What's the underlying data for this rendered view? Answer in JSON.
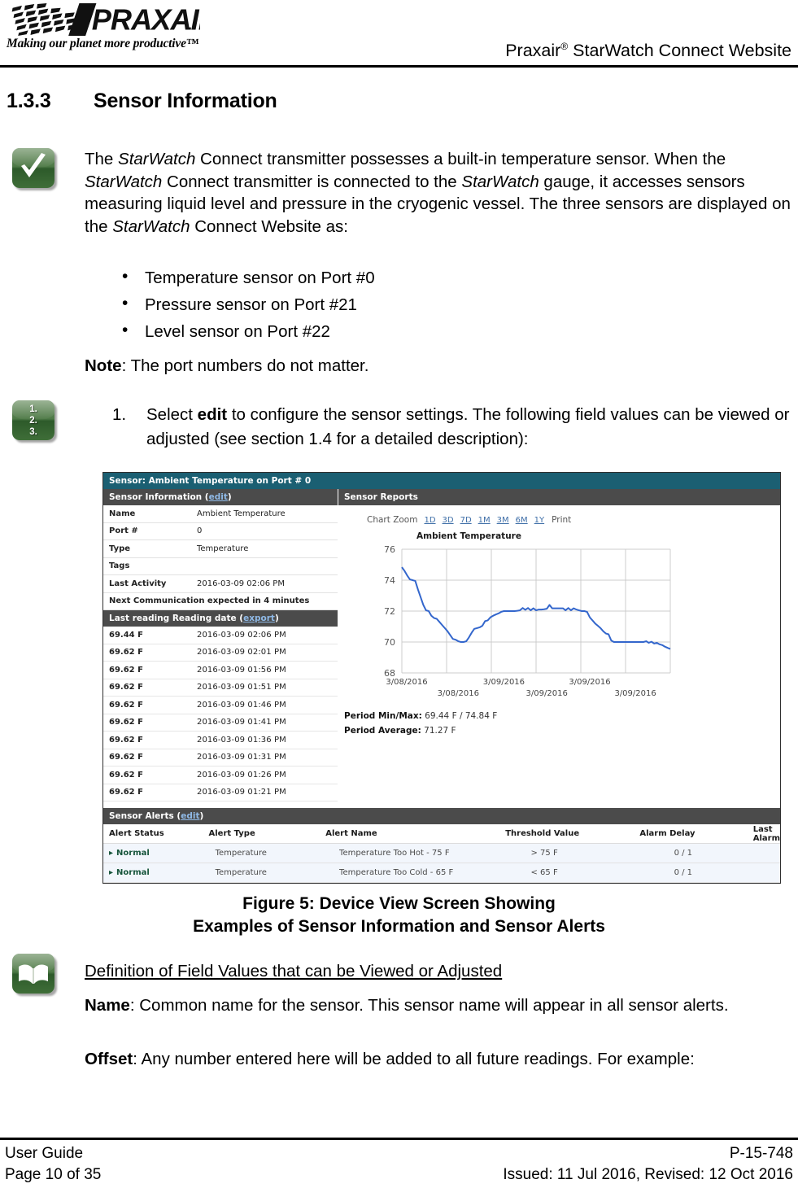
{
  "header": {
    "logo_text": "PRAXAIR",
    "logo_tagline": "Making our planet more productive™",
    "title_main": "Praxair",
    "title_sup": "®",
    "title_rest": " StarWatch Connect Website"
  },
  "section": {
    "number": "1.3.3",
    "title": "Sensor Information"
  },
  "intro": {
    "html": "The <i>StarWatch</i> Connect transmitter possesses a built-in temperature sensor.  When the <i>StarWatch</i> Connect transmitter is connected to the <i>StarWatch</i> gauge, it accesses sensors measuring liquid level and pressure in the cryogenic vessel.  The three sensors are displayed on the <i>StarWatch</i> Connect Website as:"
  },
  "bullets": [
    "Temperature sensor on Port #0",
    "Pressure sensor on Port #21",
    "Level sensor on Port #22"
  ],
  "note": {
    "label": "Note",
    "text": ":  The port numbers do not matter."
  },
  "step": {
    "number": "1.",
    "html": "Select <b>edit</b> to configure the sensor settings.  The following field values can be viewed or adjusted (see section 1.4 for a detailed description):"
  },
  "screenshot": {
    "titlebar": "Sensor: Ambient Temperature on Port # 0",
    "sensor_information": {
      "header_label": "Sensor Information (",
      "header_link": "edit",
      "header_close": ")",
      "rows": [
        {
          "key": "Name",
          "value": "Ambient Temperature"
        },
        {
          "key": "Port #",
          "value": "0"
        },
        {
          "key": "Type",
          "value": "Temperature"
        },
        {
          "key": "Tags",
          "value": ""
        },
        {
          "key": "Last Activity",
          "value": "2016-03-09 02:06 PM"
        }
      ],
      "next_comm": "Next Communication expected in 4 minutes"
    },
    "readings": {
      "header_label": "Last reading Reading date (",
      "header_link": "export",
      "header_close": ")",
      "rows": [
        {
          "reading": "69.44 F",
          "date": "2016-03-09 02:06 PM"
        },
        {
          "reading": "69.62 F",
          "date": "2016-03-09 02:01 PM"
        },
        {
          "reading": "69.62 F",
          "date": "2016-03-09 01:56 PM"
        },
        {
          "reading": "69.62 F",
          "date": "2016-03-09 01:51 PM"
        },
        {
          "reading": "69.62 F",
          "date": "2016-03-09 01:46 PM"
        },
        {
          "reading": "69.62 F",
          "date": "2016-03-09 01:41 PM"
        },
        {
          "reading": "69.62 F",
          "date": "2016-03-09 01:36 PM"
        },
        {
          "reading": "69.62 F",
          "date": "2016-03-09 01:31 PM"
        },
        {
          "reading": "69.62 F",
          "date": "2016-03-09 01:26 PM"
        },
        {
          "reading": "69.62 F",
          "date": "2016-03-09 01:21 PM"
        }
      ]
    },
    "sensor_reports": {
      "header_label": "Sensor Reports",
      "chart_zoom_label": "Chart Zoom",
      "zoom_options": [
        "1D",
        "3D",
        "7D",
        "1M",
        "3M",
        "6M",
        "1Y"
      ],
      "print_label": "Print",
      "period_min_max_label": "Period Min/Max:",
      "period_min_max_value": " 69.44 F / 74.84 F",
      "period_average_label": "Period Average:",
      "period_average_value": " 71.27 F"
    },
    "sensor_alerts": {
      "header_label": "Sensor Alerts (",
      "header_link": "edit",
      "header_close": ")",
      "columns": [
        "Alert Status",
        "Alert Type",
        "Alert Name",
        "Threshold Value",
        "Alarm Delay",
        "Last Alarm"
      ],
      "rows": [
        {
          "status": "Normal",
          "type": "Temperature",
          "name": "Temperature Too Hot - 75 F",
          "threshold": "> 75 F",
          "delay": "0 / 1",
          "last_alarm": ""
        },
        {
          "status": "Normal",
          "type": "Temperature",
          "name": "Temperature Too Cold - 65 F",
          "threshold": "< 65 F",
          "delay": "0 / 1",
          "last_alarm": ""
        }
      ]
    }
  },
  "chart_data": {
    "type": "line",
    "title": "Ambient Temperature",
    "xlabel": "",
    "ylabel": "",
    "ylim": [
      68,
      76
    ],
    "yticks": [
      68,
      70,
      72,
      74,
      76
    ],
    "xtick_labels_upper": [
      "3/08/2016",
      "3/09/2016",
      "3/09/2016"
    ],
    "xtick_labels_lower": [
      "3/08/2016",
      "3/09/2016",
      "3/09/2016"
    ],
    "grid": true,
    "legend": "none",
    "series": [
      {
        "name": "Ambient Temperature",
        "color": "#3366cc",
        "units": "F",
        "x": [
          0,
          1,
          2,
          3,
          4,
          5,
          6,
          7,
          8,
          9,
          10,
          11,
          12,
          13,
          14,
          15,
          16,
          17,
          18,
          19,
          20,
          21,
          22,
          23,
          24,
          25,
          26,
          27,
          28,
          29,
          30,
          31,
          32,
          33,
          34,
          35,
          36,
          37,
          38,
          39,
          40,
          41,
          42,
          43,
          44,
          45,
          46,
          47,
          48,
          49,
          50,
          51,
          52,
          53,
          54,
          55,
          56,
          57,
          58,
          59,
          60,
          61,
          62,
          63,
          64,
          65,
          66,
          67,
          68,
          69,
          70,
          71,
          72,
          73,
          74,
          75,
          76,
          77,
          78,
          79,
          80,
          81,
          82,
          83,
          84,
          85,
          86,
          87,
          88,
          89,
          90,
          91,
          92,
          93,
          94,
          95,
          96,
          97,
          98,
          99,
          100
        ],
        "values": [
          74.84,
          74.6,
          74.3,
          74.05,
          74.0,
          73.95,
          73.4,
          72.9,
          72.4,
          72.05,
          72.0,
          71.7,
          71.55,
          71.5,
          71.3,
          71.1,
          70.9,
          70.7,
          70.45,
          70.2,
          70.15,
          70.05,
          70.0,
          70.0,
          70.05,
          70.3,
          70.6,
          70.85,
          70.9,
          70.95,
          71.05,
          71.35,
          71.4,
          71.6,
          71.7,
          71.78,
          71.85,
          71.95,
          72.0,
          72.0,
          72.0,
          72.0,
          72.0,
          72.02,
          72.05,
          72.2,
          72.08,
          72.2,
          72.05,
          72.18,
          72.05,
          72.1,
          72.1,
          72.12,
          72.15,
          72.4,
          72.18,
          72.18,
          72.18,
          72.18,
          72.18,
          72.05,
          72.2,
          72.05,
          72.18,
          72.1,
          72.05,
          72.0,
          72.0,
          71.95,
          71.6,
          71.4,
          71.2,
          71.05,
          70.9,
          70.7,
          70.55,
          70.5,
          70.1,
          70.0,
          70.0,
          70.0,
          70.0,
          70.0,
          70.0,
          70.0,
          70.0,
          70.0,
          70.0,
          70.0,
          70.0,
          70.05,
          69.95,
          70.02,
          69.9,
          69.95,
          69.85,
          69.8,
          69.7,
          69.62,
          69.55
        ]
      }
    ],
    "period_min": 69.44,
    "period_max": 74.84,
    "period_average": 71.27
  },
  "figure": {
    "line1": "Figure 5:  Device View Screen Showing",
    "line2": "Examples of Sensor Information and Sensor Alerts"
  },
  "definitions": {
    "heading": "Definition of Field Values that can be Viewed or Adjusted",
    "name_label": "Name",
    "name_text": ":  Common name for the sensor.  This sensor name will appear in all sensor alerts.",
    "offset_label": "Offset",
    "offset_text": ":  Any number entered here will be added to all future readings.  For example:"
  },
  "footer": {
    "left_line1": "User Guide",
    "left_line2": "Page 10 of 35",
    "right_line1": "P-15-748",
    "right_line2": "Issued:  11 Jul 2016,  Revised:  12 Oct 2016"
  },
  "colors": {
    "titlebar": "#1b5f72",
    "panel_header": "#4b4b4b",
    "chart_line": "#3366cc",
    "link": "#3f6fa8",
    "alert_normal": "#17553b",
    "alert_row_bg": "#f2f6fc"
  }
}
